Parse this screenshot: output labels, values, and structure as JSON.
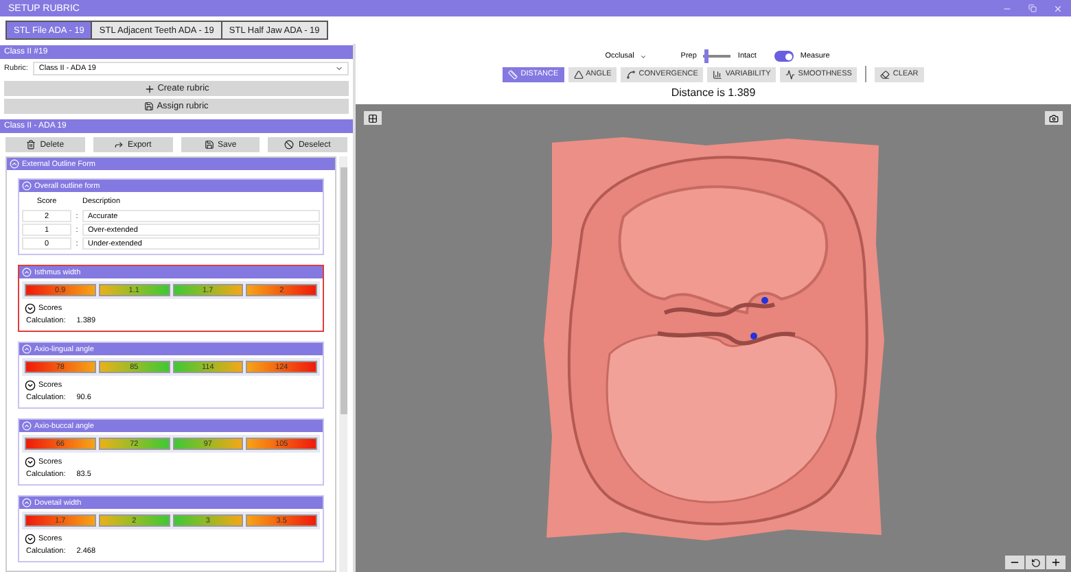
{
  "window": {
    "title": "SETUP RUBRIC"
  },
  "tabs": [
    {
      "label": "STL File ADA - 19",
      "selected": true
    },
    {
      "label": "STL Adjacent Teeth ADA - 19",
      "selected": false
    },
    {
      "label": "STL Half Jaw ADA - 19",
      "selected": false
    }
  ],
  "rubric_panel": {
    "title": "Class II #19",
    "rubric_label": "Rubric:",
    "rubric_value": "Class II - ADA 19",
    "buttons": [
      {
        "label": "Create rubric",
        "kind": "create"
      },
      {
        "label": "Assign rubric",
        "kind": "save"
      }
    ]
  },
  "rubric_editor": {
    "title": "Class II - ADA 19",
    "buttons": [
      {
        "label": "Delete",
        "kind": "delete"
      },
      {
        "label": "Export",
        "kind": "export"
      },
      {
        "label": "Save",
        "kind": "save"
      },
      {
        "label": "Deselect",
        "kind": "deselect"
      }
    ],
    "section": {
      "title": "External Outline Form",
      "expanded": true,
      "criteria": [
        {
          "kind": "table",
          "title": "Overall outline form",
          "expanded": true,
          "selected": false,
          "columns": [
            "Score",
            "Description"
          ],
          "rows": [
            {
              "score": "2",
              "separator": ":",
              "description": "Accurate"
            },
            {
              "score": "1",
              "separator": ":",
              "description": "Over-extended"
            },
            {
              "score": "0",
              "separator": ":",
              "description": "Under-extended"
            }
          ]
        },
        {
          "kind": "ranges",
          "title": "Isthmus width",
          "expanded": true,
          "selected": true,
          "ranges": [
            "0.9",
            "1.1",
            "1.7",
            "2"
          ],
          "scores_label": "Scores",
          "scores_expanded": false,
          "calculation_label": "Calculation:",
          "calculation": "1.389"
        },
        {
          "kind": "ranges",
          "title": "Axio-lingual angle",
          "expanded": true,
          "selected": false,
          "ranges": [
            "78",
            "85",
            "114",
            "124"
          ],
          "scores_label": "Scores",
          "scores_expanded": false,
          "calculation_label": "Calculation:",
          "calculation": "90.6"
        },
        {
          "kind": "ranges",
          "title": "Axio-buccal angle",
          "expanded": true,
          "selected": false,
          "ranges": [
            "66",
            "72",
            "97",
            "105"
          ],
          "scores_label": "Scores",
          "scores_expanded": false,
          "calculation_label": "Calculation:",
          "calculation": "83.5"
        },
        {
          "kind": "ranges",
          "title": "Dovetail width",
          "expanded": true,
          "selected": false,
          "ranges": [
            "1.7",
            "2",
            "3",
            "3.5"
          ],
          "scores_label": "Scores",
          "scores_expanded": false,
          "calculation_label": "Calculation:",
          "calculation": "2.468"
        }
      ]
    }
  },
  "viewer": {
    "view": "Occlusal",
    "slider": {
      "left_label": "Prep",
      "right_label": "Intact",
      "level": 0.05
    },
    "measure": {
      "label": "Measure",
      "on": true
    },
    "tools": [
      {
        "label": "DISTANCE",
        "kind": "distance",
        "selected": true
      },
      {
        "label": "ANGLE",
        "kind": "angle",
        "selected": false
      },
      {
        "label": "CONVERGENCE",
        "kind": "convergence",
        "selected": false
      },
      {
        "label": "VARIABILITY",
        "kind": "variability",
        "selected": false
      },
      {
        "label": "SMOOTHNESS",
        "kind": "smoothness",
        "selected": false
      }
    ],
    "clear": "CLEAR",
    "result": "Distance is 1.389"
  }
}
